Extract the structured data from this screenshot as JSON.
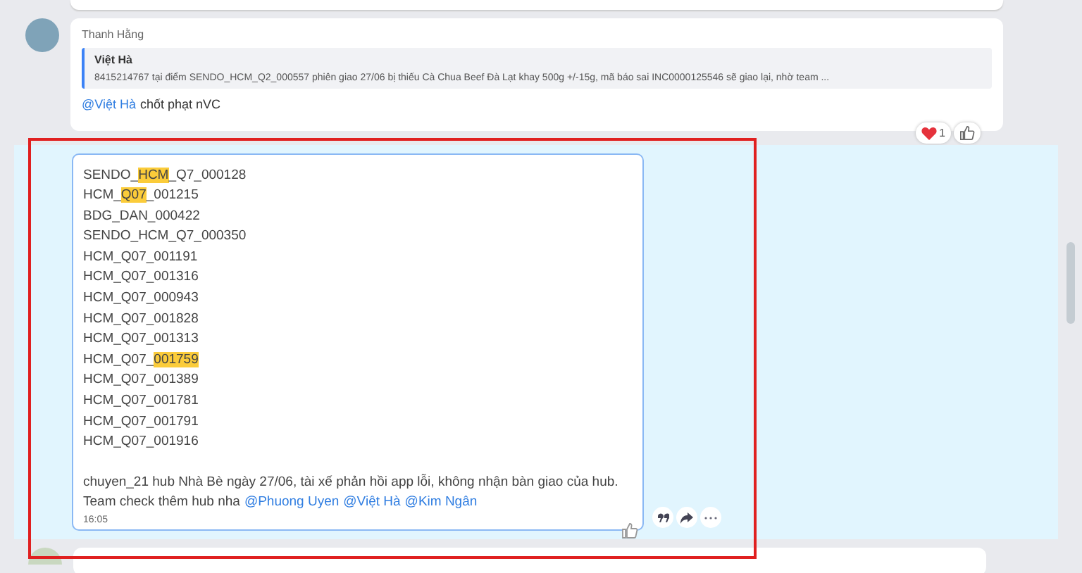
{
  "previous_message": {
    "sender": "Thanh Hằng",
    "quote": {
      "author": "Việt Hà",
      "text": "8415214767 tại điểm SENDO_HCM_Q2_000557 phiên giao 27/06 bị thiếu Cà Chua Beef Đà Lạt khay 500g +/-15g, mã báo sai INC0000125546 sẽ giao lại, nhờ team ..."
    },
    "mention": "@Việt Hà",
    "text": "chốt phạt nVC",
    "reactions": [
      {
        "kind": "heart",
        "count": "1"
      },
      {
        "kind": "like"
      }
    ]
  },
  "message": {
    "highlighted": true,
    "lines": [
      [
        {
          "text": "SENDO_",
          "highlight": false
        },
        {
          "text": "HCM",
          "highlight": true
        },
        {
          "text": "_Q7_000128",
          "highlight": false
        }
      ],
      [
        {
          "text": "HCM_",
          "highlight": false
        },
        {
          "text": "Q07",
          "highlight": true
        },
        {
          "text": "_001215",
          "highlight": false
        }
      ],
      [
        {
          "text": "BDG_DAN_000422",
          "highlight": false
        }
      ],
      [
        {
          "text": "SENDO_HCM_Q7_000350",
          "highlight": false
        }
      ],
      [
        {
          "text": "HCM_Q07_001191",
          "highlight": false
        }
      ],
      [
        {
          "text": "HCM_Q07_001316",
          "highlight": false
        }
      ],
      [
        {
          "text": "HCM_Q07_000943",
          "highlight": false
        }
      ],
      [
        {
          "text": "HCM_Q07_001828",
          "highlight": false
        }
      ],
      [
        {
          "text": "HCM_Q07_001313",
          "highlight": false
        }
      ],
      [
        {
          "text": "HCM_Q07_",
          "highlight": false
        },
        {
          "text": "001759",
          "highlight": true
        }
      ],
      [
        {
          "text": "HCM_Q07_001389",
          "highlight": false
        }
      ],
      [
        {
          "text": "HCM_Q07_001781",
          "highlight": false
        }
      ],
      [
        {
          "text": "HCM_Q07_001791",
          "highlight": false
        }
      ],
      [
        {
          "text": "HCM_Q07_001916",
          "highlight": false
        }
      ]
    ],
    "paragraph_1": "chuyen_21 hub Nhà Bè ngày 27/06, tài xế phản hồi app lỗi, không nhận bàn giao của hub.",
    "paragraph_2": "Team check thêm hub nha",
    "mentions": [
      "@Phuong Uyen",
      "@Việt Hà",
      "@Kim Ngân"
    ],
    "time": "16:05",
    "actions": [
      {
        "kind": "quote"
      },
      {
        "kind": "forward"
      },
      {
        "kind": "more"
      }
    ]
  }
}
